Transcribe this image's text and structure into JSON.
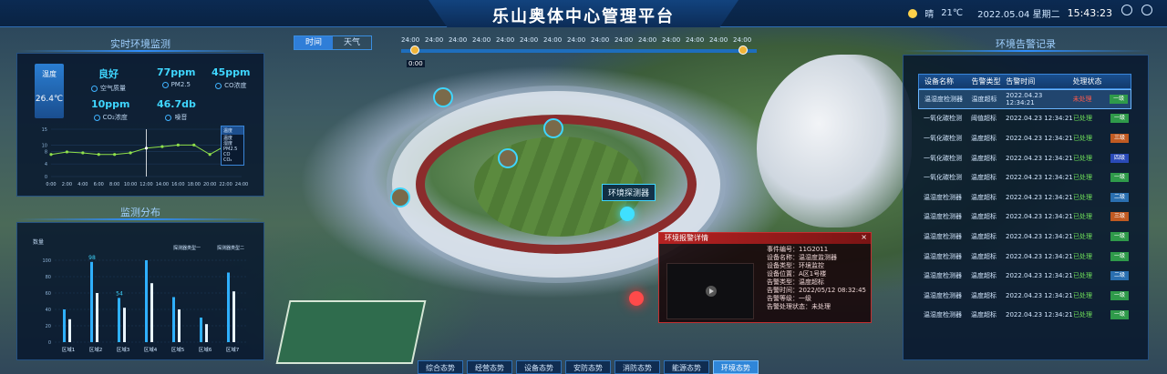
{
  "header": {
    "title": "乐山奥体中心管理平台",
    "weather": "晴",
    "temperature": "21℃",
    "date": "2022.05.04 星期二",
    "time": "15:43:23"
  },
  "env_monitor": {
    "title": "实时环境监测",
    "temp_label": "温度",
    "temp_value": "26.4℃",
    "metrics": [
      {
        "value": "良好",
        "label": "空气质量",
        "icon": "air-quality-icon"
      },
      {
        "value": "77ppm",
        "label": "PM2.5",
        "icon": "pm25-icon"
      },
      {
        "value": "45ppm",
        "label": "CO浓度",
        "icon": "co-icon"
      },
      {
        "value": "10ppm",
        "label": "CO₂浓度",
        "icon": "co2-icon"
      },
      {
        "value": "46.7db",
        "label": "噪音",
        "icon": "noise-icon"
      }
    ],
    "dropdown_selected": "温度",
    "dropdown_options": [
      "温度",
      "湿度",
      "PM2.5",
      "CO",
      "CO₂"
    ]
  },
  "chart_data": [
    {
      "type": "line",
      "title": "",
      "x": [
        "0:00",
        "2:00",
        "4:00",
        "6:00",
        "8:00",
        "10:00",
        "12:00",
        "14:00",
        "16:00",
        "18:00",
        "20:00",
        "22:00",
        "24:00"
      ],
      "y": [
        7,
        7.8,
        7.5,
        7,
        7,
        7.5,
        9,
        9.5,
        10,
        10,
        7,
        9.8,
        11
      ],
      "ylim": [
        0,
        15
      ],
      "yticks": [
        "0",
        "4",
        "8",
        "10",
        "15"
      ]
    },
    {
      "type": "bar",
      "title": "监测分布",
      "ylabel": "数量",
      "categories": [
        "区域1",
        "区域2",
        "区域3",
        "区域4",
        "区域5",
        "区域6",
        "区域7"
      ],
      "series": [
        {
          "name": "探测器类型一",
          "values": [
            40,
            98,
            54,
            100,
            55,
            30,
            85
          ]
        },
        {
          "name": "探测器类型二",
          "values": [
            28,
            60,
            42,
            72,
            40,
            22,
            62
          ]
        }
      ],
      "data_labels": {
        "区域2": "98",
        "区域3": "54"
      },
      "ylim": [
        0,
        100
      ],
      "yticks": [
        "0",
        "20",
        "40",
        "60",
        "80",
        "100"
      ]
    }
  ],
  "toggle": {
    "options": [
      "时间",
      "天气"
    ],
    "active": "时间"
  },
  "timeline": {
    "labels": [
      "24:00",
      "24:00",
      "24:00",
      "24:00",
      "24:00",
      "24:00",
      "24:00",
      "24:00",
      "24:00",
      "24:00",
      "24:00",
      "24:00",
      "24:00",
      "24:00",
      "24:00"
    ],
    "current": "0:00"
  },
  "sensor_label": "环境探测器",
  "alarm_popup": {
    "title": "环境报警详情",
    "close": "×",
    "lines": [
      "事件编号：11G2011",
      "设备名称：温湿度监测器",
      "设备类型：环境监控",
      "设备位置：A区1号楼",
      "告警类型：温度超标",
      "告警时间：2022/05/12 08:32:45",
      "告警等级：一级",
      "告警处理状态：未处理"
    ]
  },
  "alarm_records": {
    "title": "环境告警记录",
    "columns": [
      "设备名称",
      "告警类型",
      "告警时间",
      "处理状态"
    ],
    "rows": [
      {
        "name": "温湿度检测器",
        "type": "温度超标",
        "time": "2022.04.23 12:34:21",
        "status": "未处理",
        "level": "一级",
        "lvl": 1
      },
      {
        "name": "一氧化碳检测",
        "type": "阈值超标",
        "time": "2022.04.23 12:34:21",
        "status": "已处理",
        "level": "一级",
        "lvl": 1
      },
      {
        "name": "一氧化碳检测",
        "type": "温度超标",
        "time": "2022.04.23 12:34:21",
        "status": "已处理",
        "level": "三级",
        "lvl": 3
      },
      {
        "name": "一氧化碳检测",
        "type": "温度超标",
        "time": "2022.04.23 12:34:21",
        "status": "已处理",
        "level": "四级",
        "lvl": 4
      },
      {
        "name": "一氧化碳检测",
        "type": "温度超标",
        "time": "2022.04.23 12:34:21",
        "status": "已处理",
        "level": "一级",
        "lvl": 1
      },
      {
        "name": "温湿度检测器",
        "type": "温度超标",
        "time": "2022.04.23 12:34:21",
        "status": "已处理",
        "level": "二级",
        "lvl": 2
      },
      {
        "name": "温湿度检测器",
        "type": "温度超标",
        "time": "2022.04.23 12:34:21",
        "status": "已处理",
        "level": "三级",
        "lvl": 3
      },
      {
        "name": "温湿度检测器",
        "type": "温度超标",
        "time": "2022.04.23 12:34:21",
        "status": "已处理",
        "level": "一级",
        "lvl": 1
      },
      {
        "name": "温湿度检测器",
        "type": "温度超标",
        "time": "2022.04.23 12:34:21",
        "status": "已处理",
        "level": "一级",
        "lvl": 1
      },
      {
        "name": "温湿度检测器",
        "type": "温度超标",
        "time": "2022.04.23 12:34:21",
        "status": "已处理",
        "level": "二级",
        "lvl": 2
      },
      {
        "name": "温湿度检测器",
        "type": "温度超标",
        "time": "2022.04.23 12:34:21",
        "status": "已处理",
        "level": "一级",
        "lvl": 1
      },
      {
        "name": "温湿度检测器",
        "type": "温度超标",
        "time": "2022.04.23 12:34:21",
        "status": "已处理",
        "level": "一级",
        "lvl": 1
      }
    ]
  },
  "tabs": {
    "items": [
      "综合态势",
      "经营态势",
      "设备态势",
      "安防态势",
      "消防态势",
      "能源态势",
      "环境态势"
    ],
    "active": "环境态势"
  },
  "colors": {
    "accent": "#3fd6ff",
    "series1": "#2fb0ff",
    "series2": "#e8f4ff",
    "line": "#8fe04a",
    "alarm": "#c33030"
  }
}
